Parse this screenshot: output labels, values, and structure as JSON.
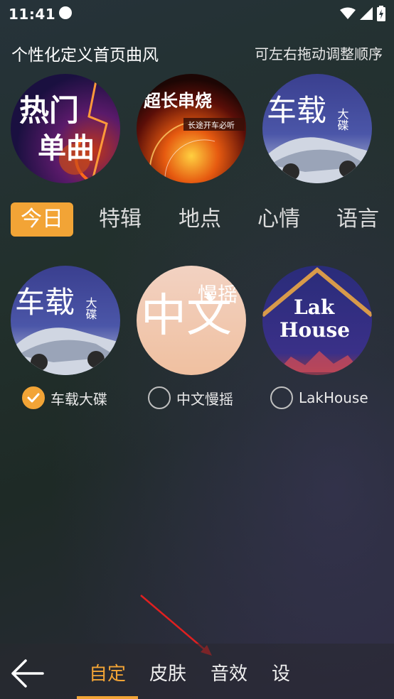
{
  "status": {
    "time": "11:41"
  },
  "header": {
    "title": "个性化定义首页曲风",
    "hint": "可左右拖动调整顺序"
  },
  "featured": [
    {
      "line1": "热门",
      "line2": "单曲"
    },
    {
      "line1": "超长串烧",
      "line2": "长途开车必听"
    },
    {
      "line1": "车载",
      "line2": "大碟"
    }
  ],
  "tabs": [
    "今日",
    "特辑",
    "地点",
    "心情",
    "语言"
  ],
  "options": [
    {
      "label": "车载大碟",
      "art1": "车载",
      "art2": "大碟",
      "checked": true
    },
    {
      "label": "中文慢摇",
      "art1": "中文",
      "art2": "慢摇",
      "checked": false
    },
    {
      "label": "LakHouse",
      "art1": "Lak",
      "art2": "House",
      "checked": false
    }
  ],
  "bottom_nav": {
    "items": [
      "自定",
      "皮肤",
      "音效",
      "设"
    ]
  },
  "colors": {
    "accent": "#f2a436",
    "arrow": "#e02020"
  }
}
